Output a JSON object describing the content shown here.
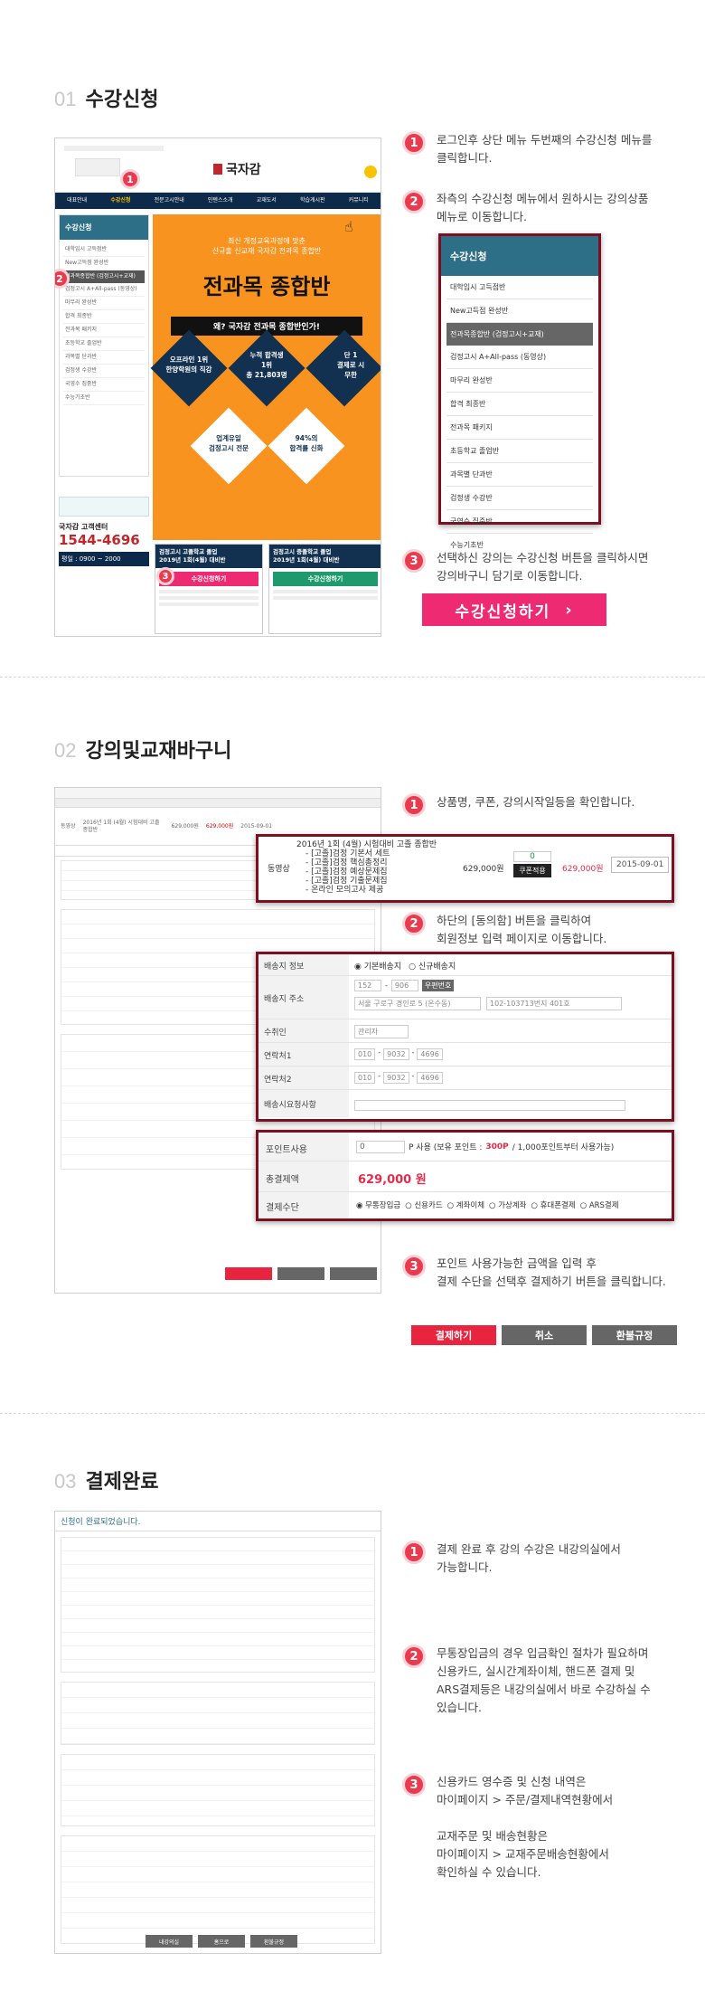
{
  "sections": [
    {
      "num": "01",
      "title": "수강신청"
    },
    {
      "num": "02",
      "title": "강의및교재바구니"
    },
    {
      "num": "03",
      "title": "결제완료"
    }
  ],
  "s1": {
    "steps": [
      {
        "n": "1",
        "text": "로그인후 상단 메뉴 두번째의 수강신청 메뉴를\n클릭합니다."
      },
      {
        "n": "2",
        "text": "좌측의 수강신청 메뉴에서  원하시는 강의상품\n메뉴로 이동합니다."
      },
      {
        "n": "3",
        "text": "선택하신 강의는 수강신청 버튼을 클릭하시면\n강의바구니 담기로 이동합니다."
      }
    ],
    "menu_title": "수강신청",
    "menu_items": [
      "대학입시 고득점반",
      "New고득점 완성반",
      "전과목종합반 (검정고시+교재)",
      "검정고시 A+All-pass (동영상)",
      "마무리 완성반",
      "합격 최종반",
      "전과목 패키지",
      "초등학교 졸업반",
      "과목별 단과반",
      "검정생 수강반",
      "국영수 집중반",
      "수능기초반"
    ],
    "apply_button": "수강신청하기",
    "shot": {
      "logo": "국자감",
      "nav": [
        "대표안내",
        "수강신청",
        "전문고시안내",
        "인텐스소개",
        "교재도서",
        "학습게시판",
        "커뮤니티"
      ],
      "banner_small": "최신 개정교육과정에 맞춘\n신규출 신교재 국자감 전과목 종합반",
      "banner_title": "전과목 종합반",
      "banner_sub": "왜? 국자감 전과목 종합반인가!",
      "d1": "오프라인 1위\n한양학원의 직강",
      "d2": "누적 합격생\n1위\n총 21,803명",
      "d3": "단 1\n결제로 시\n무한",
      "d4": "업계유일\n검정고시 전문",
      "d5": "94%의\n합격률 신화",
      "callcenter_label": "국자감 고객센터",
      "phone": "1544-4696",
      "hours": "평일 : 0900 ~ 2000",
      "card1_title": "검정고시 고졸학교 졸업\n2019년 1회(4월) 대비반",
      "card2_title": "검정고시 중졸학교 졸업\n2019년 1회(4월) 대비반",
      "card_btn": "수강신청하기"
    }
  },
  "s2": {
    "steps": [
      {
        "n": "1",
        "text": "상품명, 쿠폰, 강의시작일등을 확인합니다."
      },
      {
        "n": "2",
        "text": "하단의 [동의함] 버튼을 클릭하여\n회원정보 입력 페이지로 이동합니다."
      },
      {
        "n": "3",
        "text": "포인트 사용가능한 금액을 입력 후\n결제 수단을 선택후 결제하기 버튼을 클릭합니다."
      }
    ],
    "product": {
      "type": "동영상",
      "name": "2016년 1회 (4월) 시험대비 고졸 종합반",
      "items": [
        "[고졸]검정 기본서 세트",
        "[고졸]검정 핵심총정리",
        "[고졸]검정 예상문제집",
        "[고졸]검정 기출문제집",
        "온라인 모의고사 제공"
      ],
      "price": "629,000원",
      "coupon": "0",
      "coupon_btn": "쿠폰적용",
      "pay_price": "629,000원",
      "start_date": "2015-09-01"
    },
    "shipping": {
      "info_label": "배송지 정보",
      "radio1": "기본배송지",
      "radio2": "신규배송지",
      "addr_label": "배송지 주소",
      "zip1": "152",
      "zip2": "906",
      "zip_btn": "우편번호",
      "addr1": "서울 구로구 경인로 5 (온수동)",
      "addr2": "102-103713번지 401호",
      "recv_label": "수취인",
      "recv": "관리자",
      "tel1_label": "연락처1",
      "tel1": [
        "010",
        "9032",
        "4696"
      ],
      "tel2_label": "연락처2",
      "tel2": [
        "010",
        "9032",
        "4696"
      ],
      "memo_label": "배송시요청사항"
    },
    "payment": {
      "point_label": "포인트사용",
      "point_value": "0",
      "point_text_a": "P 사용 (보유 포인트 :",
      "point_amount": "300P",
      "point_text_b": "/ 1,000포인트부터 사용가능)",
      "total_label": "총결제액",
      "total": "629,000 원",
      "method_label": "결제수단",
      "methods": [
        "무통장입금",
        "신용카드",
        "계좌이체",
        "가상계좌",
        "휴대폰결제",
        "ARS결제"
      ]
    },
    "buttons": [
      "결제하기",
      "취소",
      "환불규정"
    ]
  },
  "s3": {
    "steps": [
      {
        "n": "1",
        "text": "결제 완료 후 강의 수강은 내강의실에서\n가능합니다."
      },
      {
        "n": "2",
        "text": "무통장입금의 경우 입금확인 절차가 필요하며\n신용카드, 실시간계좌이체, 핸드폰 결제 및\nARS결제등은 내강의실에서 바로 수강하실 수\n있습니다."
      },
      {
        "n": "3",
        "text": "신용카드 영수증 및 신청 내역은\n마이페이지 > 주문/결제내역현황에서\n\n교재주문 및 배송현황은\n마이페이지 > 교재주문배송현황에서\n확인하실 수 있습니다."
      }
    ],
    "complete_msg": "신청이 완료되었습니다.",
    "buttons": [
      "내강의실",
      "홈으로",
      "환불규정"
    ]
  }
}
